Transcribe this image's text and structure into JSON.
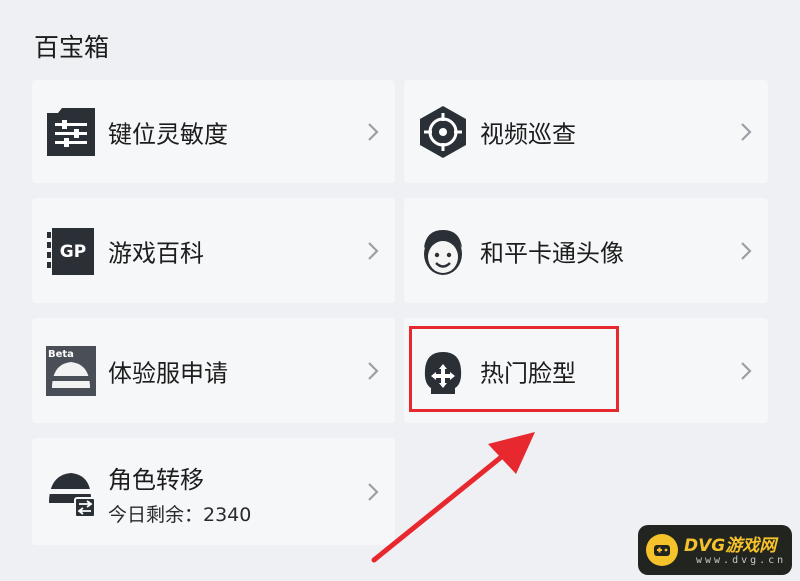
{
  "section_title": "百宝箱",
  "items": [
    {
      "label": "键位灵敏度",
      "icon": "sliders-icon"
    },
    {
      "label": "视频巡查",
      "icon": "crosshair-icon"
    },
    {
      "label": "游戏百科",
      "icon": "gp-book-icon"
    },
    {
      "label": "和平卡通头像",
      "icon": "cartoon-avatar-icon"
    },
    {
      "label": "体验服申请",
      "icon": "beta-helmet-icon"
    },
    {
      "label": "热门脸型",
      "icon": "face-move-icon"
    },
    {
      "label": "角色转移",
      "sub": "今日剩余：2340",
      "icon": "helmet-transfer-icon"
    }
  ],
  "watermark": {
    "text": "DVG游戏网",
    "url": "www.dvg.cn"
  },
  "colors": {
    "highlight": "#e8282f",
    "arrow": "#e8282f",
    "icon_dark": "#2b2f36"
  }
}
